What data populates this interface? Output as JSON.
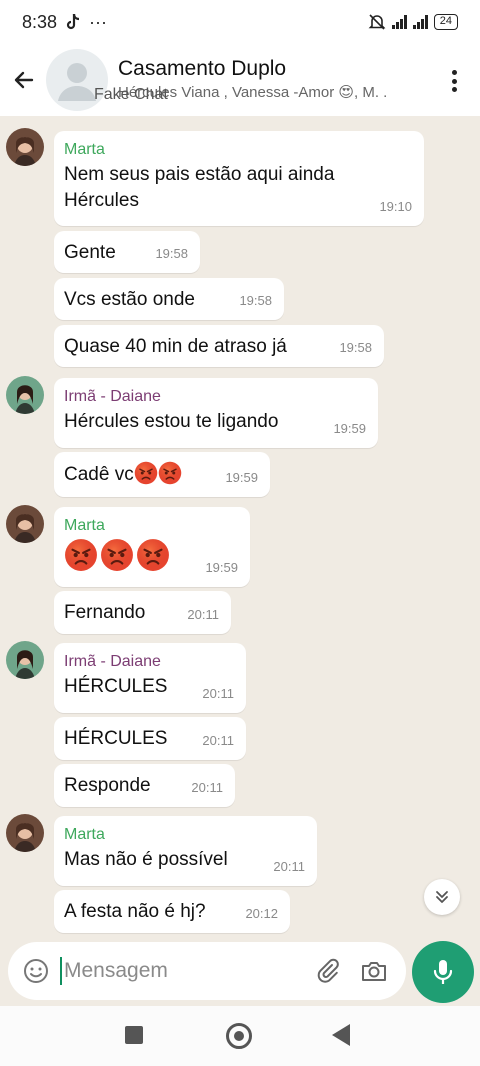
{
  "status": {
    "time": "8:38",
    "tiktok_icon": "tiktok-icon",
    "dots": "···",
    "battery": "24"
  },
  "header": {
    "title": "Casamento Duplo",
    "subtitle": "Hércules Viana , Vanessa -Amor 😍, M. .",
    "watermark": "Fake Chat"
  },
  "messages": [
    {
      "sender": "Marta",
      "text_l1": "Nem seus pais estão aqui ainda",
      "text_l2": "Hércules",
      "time": "19:10"
    },
    {
      "text": "Gente",
      "time": "19:58"
    },
    {
      "text": "Vcs estão onde",
      "time": "19:58"
    },
    {
      "text": "Quase 40 min de atraso já",
      "time": "19:58"
    },
    {
      "sender": "Irmã - Daiane",
      "text": "Hércules estou te ligando",
      "time": "19:59"
    },
    {
      "text": "Cadê vc",
      "time": "19:59"
    },
    {
      "sender": "Marta",
      "time": "19:59"
    },
    {
      "text": "Fernando",
      "time": "20:11"
    },
    {
      "sender": "Irmã - Daiane",
      "text": "HÉRCULES",
      "time": "20:11"
    },
    {
      "text": "HÉRCULES",
      "time": "20:11"
    },
    {
      "text": "Responde",
      "time": "20:11"
    },
    {
      "sender": "Marta",
      "text": "Mas não é possível",
      "time": "20:11"
    },
    {
      "text": "A festa não é hj?",
      "time": "20:12"
    }
  ],
  "input": {
    "placeholder": "Mensagem"
  },
  "colors": {
    "green_sender": "#3ea85c",
    "purple_sender": "#7c3d73",
    "mic": "#1f9e73",
    "chat_bg": "#f0ebe3"
  }
}
